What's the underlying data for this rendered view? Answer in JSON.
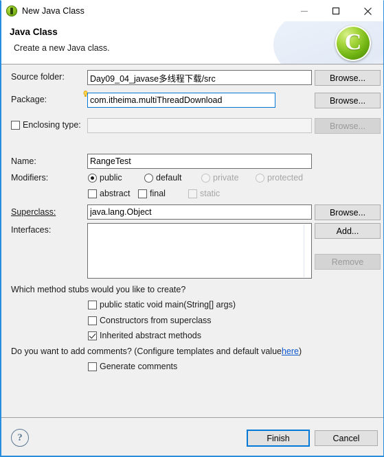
{
  "window": {
    "title": "New Java Class",
    "icon": "java-class-icon",
    "minimize_label": "—",
    "maximize_label": "□",
    "close_label": "✕"
  },
  "header": {
    "title": "Java Class",
    "subtitle": "Create a new Java class.",
    "logo_letter": "C",
    "logo_name": "eclipse-class-logo"
  },
  "form": {
    "source_folder": {
      "label": "Source folder:",
      "value": "Day09_04_javase多线程下载/src",
      "button": "Browse..."
    },
    "package": {
      "label": "Package:",
      "value": "com.itheima.multiThreadDownload",
      "button": "Browse...",
      "focused": true,
      "marker": "content-assist-marker"
    },
    "enclosing_type": {
      "label": "Enclosing type:",
      "value": "",
      "checked": false,
      "button": "Browse...",
      "disabled": true
    },
    "name": {
      "label": "Name:",
      "value": "RangeTest"
    },
    "modifiers": {
      "label": "Modifiers:",
      "radios": [
        {
          "label": "public",
          "checked": true,
          "disabled": false
        },
        {
          "label": "default",
          "checked": false,
          "disabled": false
        },
        {
          "label": "private",
          "checked": false,
          "disabled": true
        },
        {
          "label": "protected",
          "checked": false,
          "disabled": true
        }
      ],
      "checkboxes": [
        {
          "label": "abstract",
          "checked": false,
          "disabled": false
        },
        {
          "label": "final",
          "checked": false,
          "disabled": false
        },
        {
          "label": "static",
          "checked": false,
          "disabled": true
        }
      ]
    },
    "superclass": {
      "label": "Superclass:",
      "value": "java.lang.Object",
      "button": "Browse..."
    },
    "interfaces": {
      "label": "Interfaces:",
      "items": [],
      "add_button": "Add...",
      "remove_button": "Remove",
      "remove_disabled": true
    },
    "stubs": {
      "question": "Which method stubs would you like to create?",
      "options": [
        {
          "label": "public static void main(String[] args)",
          "checked": false
        },
        {
          "label": "Constructors from superclass",
          "checked": false
        },
        {
          "label": "Inherited abstract methods",
          "checked": true
        }
      ]
    },
    "comments": {
      "text_before": "Do you want to add comments? (Configure templates and default value ",
      "link": "here",
      "text_after": ")",
      "option": {
        "label": "Generate comments",
        "checked": false
      }
    }
  },
  "footer": {
    "help_label": "?",
    "finish": "Finish",
    "cancel": "Cancel"
  },
  "colors": {
    "window_border": "#2a8ddc",
    "focus_border": "#0078d7",
    "body_bg": "#f0f0f0",
    "link": "#0b57d0",
    "logo_green": "#6fb312"
  }
}
